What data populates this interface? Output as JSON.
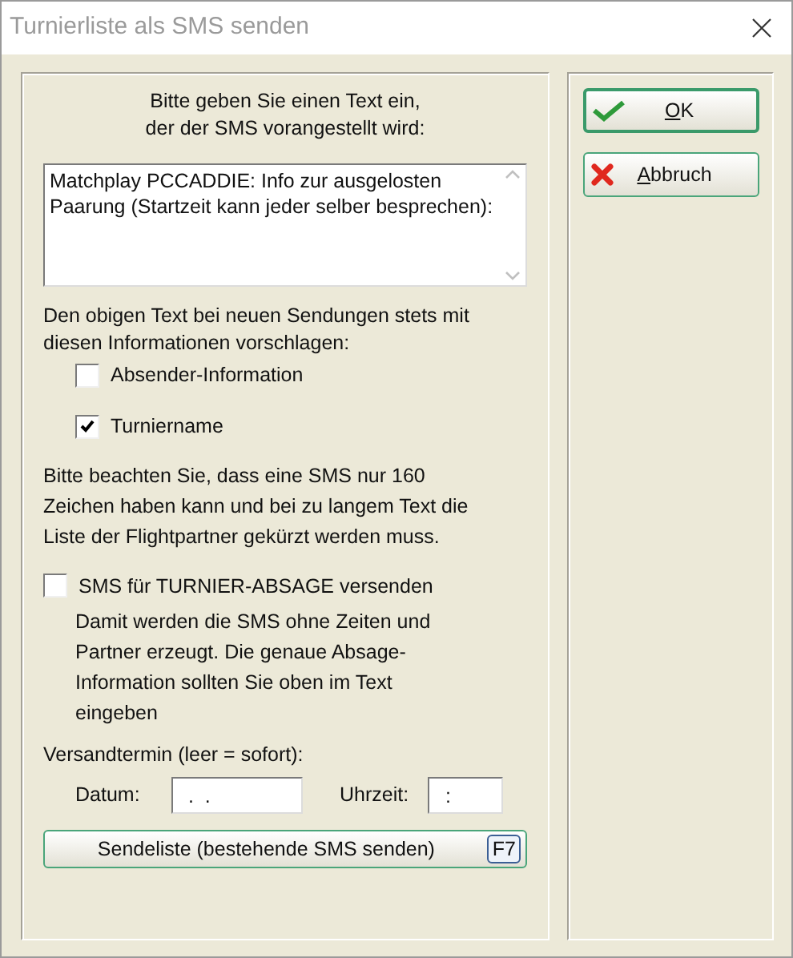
{
  "window": {
    "title": "Turnierliste als SMS senden"
  },
  "intro": "Bitte geben Sie einen Text ein,\nder der SMS vorangestellt wird:",
  "message": {
    "value": "Matchplay PCCADDIE: Info zur ausgelosten Paarung (Startzeit kann jeder selber besprechen):"
  },
  "suggest_label": "Den obigen Text bei neuen Sendungen stets mit diesen Informationen vorschlagen:",
  "suggest_options": [
    {
      "label": "Absender-Information",
      "checked": false
    },
    {
      "label": "Turniername",
      "checked": true
    }
  ],
  "note": "Bitte beachten Sie, dass eine SMS nur 160 Zeichen haben kann und bei zu langem Text die Liste der Flightpartner gekürzt werden muss.",
  "cancel_option": {
    "label": "SMS für TURNIER-ABSAGE versenden",
    "checked": false
  },
  "cancel_note": "Damit werden die SMS ohne Zeiten und Partner erzeugt. Die genaue Absage-Information sollten Sie oben im Text eingeben",
  "schedule": {
    "label": "Versandtermin (leer = sofort):",
    "date_label": "Datum:",
    "date_value": " .  .",
    "time_label": "Uhrzeit:",
    "time_value": ":"
  },
  "send_list_button": {
    "label": "Sendeliste (bestehende SMS senden)",
    "shortcut": "F7"
  },
  "buttons": [
    {
      "kind": "ok",
      "label": "OK"
    },
    {
      "kind": "cancel",
      "label": "Abbruch"
    }
  ]
}
